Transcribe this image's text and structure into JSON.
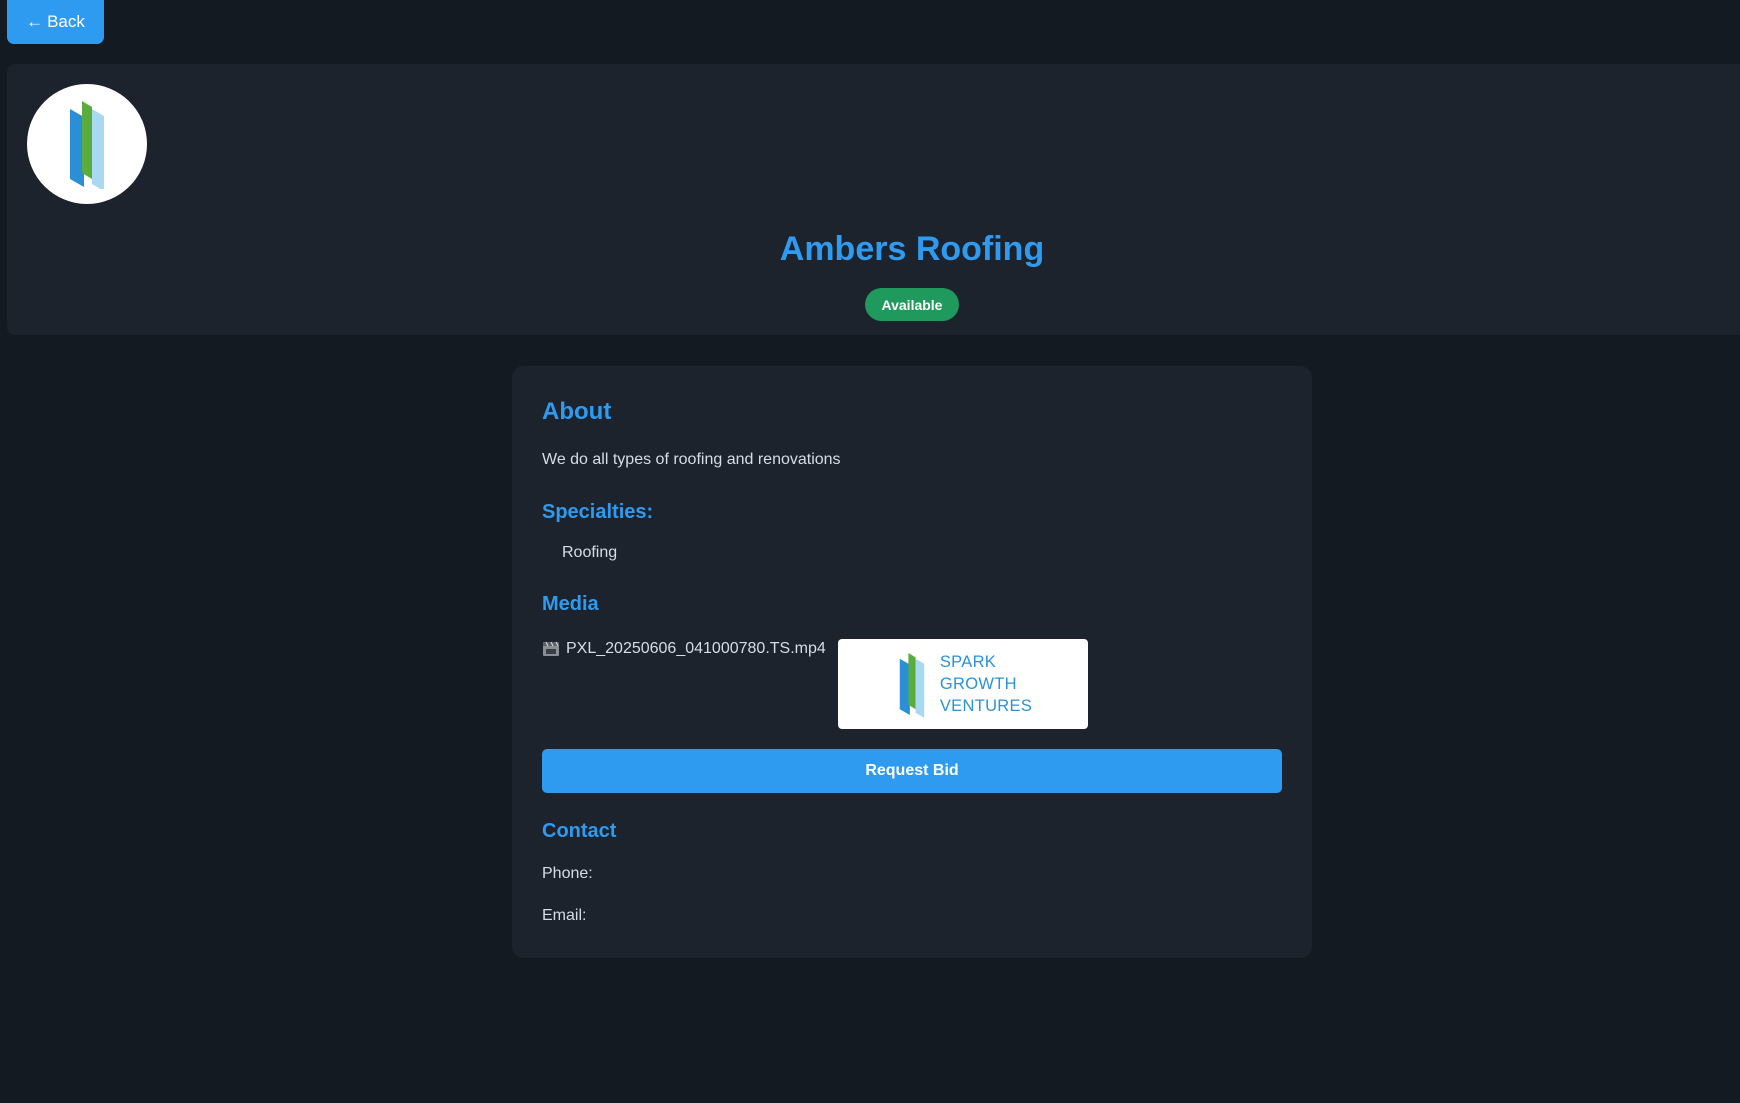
{
  "nav": {
    "back_arrow": "←",
    "back_label": "Back"
  },
  "header": {
    "avatar_icon": "spark-logo-icon",
    "company_name": "Ambers Roofing",
    "status": "Available"
  },
  "about": {
    "heading": "About",
    "description": "We do all types of roofing and renovations"
  },
  "specialties": {
    "heading": "Specialties:",
    "items": [
      "Roofing"
    ]
  },
  "media": {
    "heading": "Media",
    "file_icon": "video-file-icon",
    "file_name": "PXL_20250606_041000780.TS.mp4",
    "image_logo_lines": [
      "SPARK",
      "GROWTH",
      "VENTURES"
    ]
  },
  "actions": {
    "request_bid_label": "Request Bid"
  },
  "contact": {
    "heading": "Contact",
    "phone_label": "Phone:",
    "phone_value": "",
    "email_label": "Email:",
    "email_value": ""
  },
  "colors": {
    "accent": "#2f9bf0",
    "status_green": "#1f9a5c",
    "background": "#131a22",
    "card": "#1c232c"
  }
}
